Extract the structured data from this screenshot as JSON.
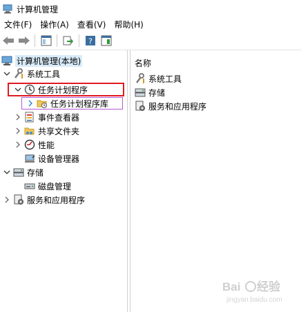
{
  "window": {
    "title": "计算机管理"
  },
  "menu": [
    "文件(F)",
    "操作(A)",
    "查看(V)",
    "帮助(H)"
  ],
  "tree": {
    "root": "计算机管理(本地)",
    "system_tools": "系统工具",
    "task_scheduler": "任务计划程序",
    "task_scheduler_library": "任务计划程序库",
    "event_viewer": "事件查看器",
    "shared_folders": "共享文件夹",
    "performance": "性能",
    "device_manager": "设备管理器",
    "storage": "存储",
    "disk_management": "磁盘管理",
    "services_apps": "服务和应用程序"
  },
  "list": {
    "column_name": "名称",
    "items": [
      "系统工具",
      "存储",
      "服务和应用程序"
    ]
  },
  "watermark": {
    "text": "Baidu经验",
    "url_text": "jingyan.baidu.com"
  },
  "colors": {
    "highlight_red": "#e0191f",
    "highlight_purple": "#b25ad7",
    "selection": "#d9ebf9"
  }
}
